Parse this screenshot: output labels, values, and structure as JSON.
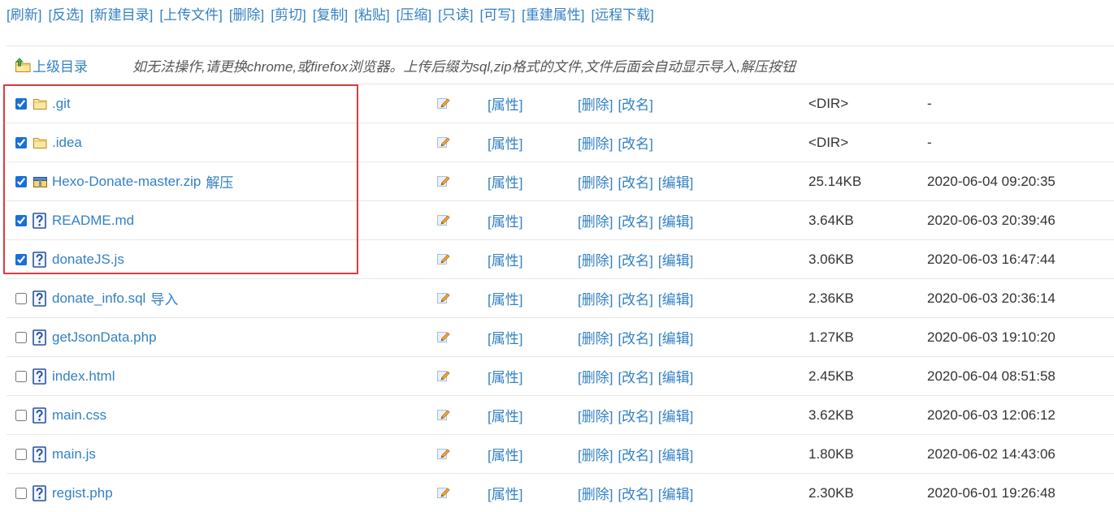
{
  "toolbar": {
    "actions": [
      "[刷新]",
      "[反选]",
      "[新建目录]",
      "[上传文件]",
      "[删除]",
      "[剪切]",
      "[复制]",
      "[粘贴]",
      "[压缩]",
      "[只读]",
      "[可写]",
      "[重建属性]",
      "[远程下载]"
    ]
  },
  "parent_dir": {
    "icon": "folder-up-icon",
    "label": "上级目录"
  },
  "notice": "如无法操作,请更换chrome,或firefox浏览器。上传后缀为sql,zip格式的文件,文件后面会自动显示导入,解压按钮",
  "row_labels": {
    "properties": "[属性]",
    "edit_icon": "pencil-icon"
  },
  "files": [
    {
      "name": ".git",
      "icon": "folder-icon",
      "checked": true,
      "actions": [
        "[删除]",
        "[改名]"
      ],
      "size": "<DIR>",
      "modified": "-"
    },
    {
      "name": ".idea",
      "icon": "folder-icon",
      "checked": true,
      "actions": [
        "[删除]",
        "[改名]"
      ],
      "size": "<DIR>",
      "modified": "-"
    },
    {
      "name": "Hexo-Donate-master.zip",
      "extra": "解压",
      "icon": "zip-icon",
      "checked": true,
      "actions": [
        "[删除]",
        "[改名]",
        "[编辑]"
      ],
      "size": "25.14KB",
      "modified": "2020-06-04 09:20:35"
    },
    {
      "name": "README.md",
      "icon": "unknown-file-icon",
      "checked": true,
      "actions": [
        "[删除]",
        "[改名]",
        "[编辑]"
      ],
      "size": "3.64KB",
      "modified": "2020-06-03 20:39:46"
    },
    {
      "name": "donateJS.js",
      "icon": "unknown-file-icon",
      "checked": true,
      "actions": [
        "[删除]",
        "[改名]",
        "[编辑]"
      ],
      "size": "3.06KB",
      "modified": "2020-06-03 16:47:44"
    },
    {
      "name": "donate_info.sql",
      "extra": "导入",
      "icon": "unknown-file-icon",
      "checked": false,
      "actions": [
        "[删除]",
        "[改名]",
        "[编辑]"
      ],
      "size": "2.36KB",
      "modified": "2020-06-03 20:36:14"
    },
    {
      "name": "getJsonData.php",
      "icon": "unknown-file-icon",
      "checked": false,
      "actions": [
        "[删除]",
        "[改名]",
        "[编辑]"
      ],
      "size": "1.27KB",
      "modified": "2020-06-03 19:10:20"
    },
    {
      "name": "index.html",
      "icon": "unknown-file-icon",
      "checked": false,
      "actions": [
        "[删除]",
        "[改名]",
        "[编辑]"
      ],
      "size": "2.45KB",
      "modified": "2020-06-04 08:51:58"
    },
    {
      "name": "main.css",
      "icon": "unknown-file-icon",
      "checked": false,
      "actions": [
        "[删除]",
        "[改名]",
        "[编辑]"
      ],
      "size": "3.62KB",
      "modified": "2020-06-03 12:06:12"
    },
    {
      "name": "main.js",
      "icon": "unknown-file-icon",
      "checked": false,
      "actions": [
        "[删除]",
        "[改名]",
        "[编辑]"
      ],
      "size": "1.80KB",
      "modified": "2020-06-02 14:43:06"
    },
    {
      "name": "regist.php",
      "icon": "unknown-file-icon",
      "checked": false,
      "actions": [
        "[删除]",
        "[改名]",
        "[编辑]"
      ],
      "size": "2.30KB",
      "modified": "2020-06-01 19:26:48"
    }
  ],
  "colors": {
    "link": "#3381c4",
    "text": "#333333",
    "notice": "#555555",
    "divider": "#e8e8e8",
    "highlight": "#e03a3e",
    "checkbox": "#1a6fd8"
  }
}
